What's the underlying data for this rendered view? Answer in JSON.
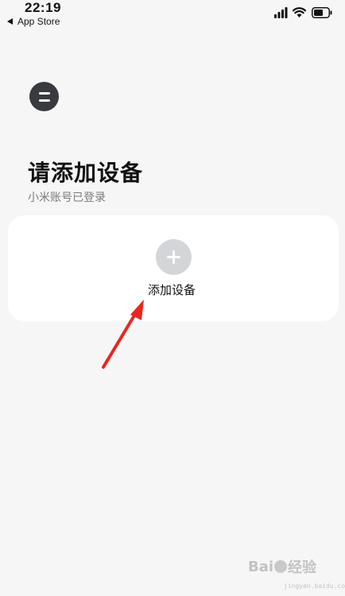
{
  "status_bar": {
    "time": "22:19",
    "back_label": "App Store"
  },
  "page": {
    "title": "请添加设备",
    "subtitle": "小米账号已登录"
  },
  "card": {
    "add_label": "添加设备"
  },
  "watermark": {
    "brand_left": "Bai",
    "brand_right": "经验",
    "sub": "jingyan.baidu.com"
  },
  "colors": {
    "background": "#f6f6f6",
    "card": "#ffffff",
    "menu_button": "#393a3f",
    "add_circle": "#d4d5d9",
    "arrow": "#e8261f"
  }
}
